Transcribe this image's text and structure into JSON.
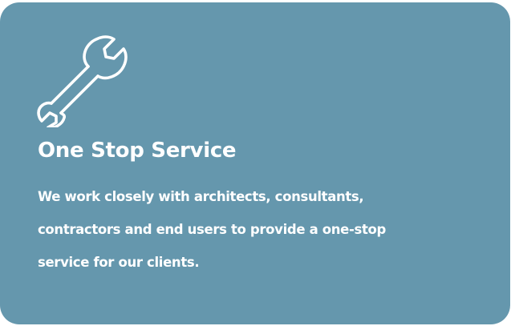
{
  "card": {
    "icon": "wrench-icon",
    "title": "One Stop Service",
    "description_lines": [
      "We work closely with architects, consultants,",
      "contractors and end users to provide a one-stop",
      "service for our clients."
    ]
  },
  "colors": {
    "card_background": "#6597ad",
    "text": "#ffffff"
  }
}
